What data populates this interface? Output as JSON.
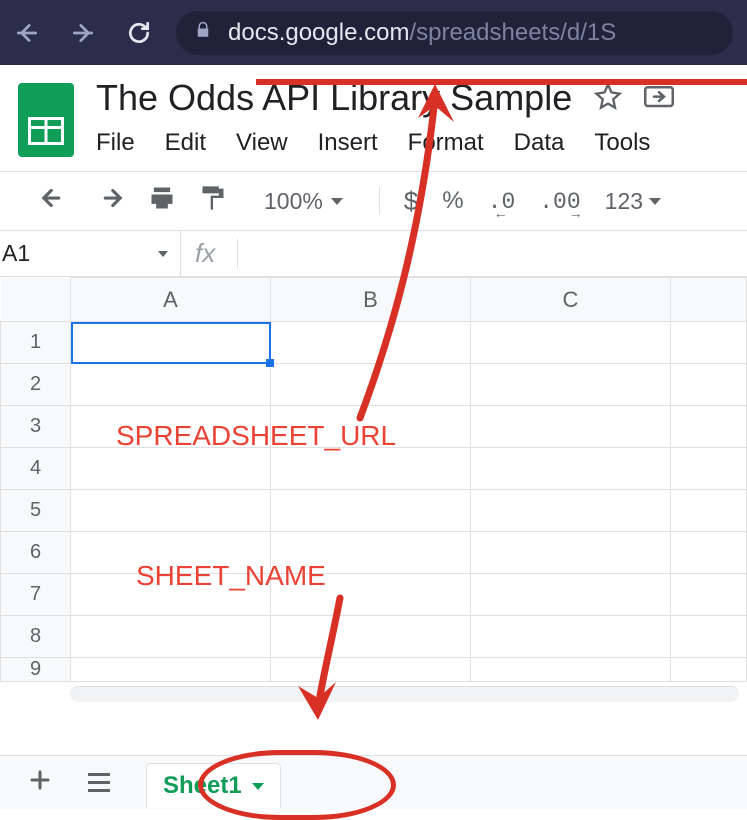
{
  "browser": {
    "url_host": "docs.google.com",
    "url_path": "/spreadsheets/d/1S"
  },
  "doc": {
    "title": "The Odds API Library Sample"
  },
  "menu": {
    "file": "File",
    "edit": "Edit",
    "view": "View",
    "insert": "Insert",
    "format": "Format",
    "data": "Data",
    "tools": "Tools"
  },
  "toolbar": {
    "zoom": "100%",
    "currency": "$",
    "percent": "%",
    "dec_less": ".0",
    "dec_more": ".00",
    "fmt123": "123"
  },
  "namebox": {
    "ref": "A1",
    "fx": "fx"
  },
  "columns": {
    "A": "A",
    "B": "B",
    "C": "C"
  },
  "rows": [
    "1",
    "2",
    "3",
    "4",
    "5",
    "6",
    "7",
    "8",
    "9"
  ],
  "sheet_tab": {
    "name": "Sheet1"
  },
  "annotations": {
    "url_label": "SPREADSHEET_URL",
    "sheet_label": "SHEET_NAME"
  }
}
